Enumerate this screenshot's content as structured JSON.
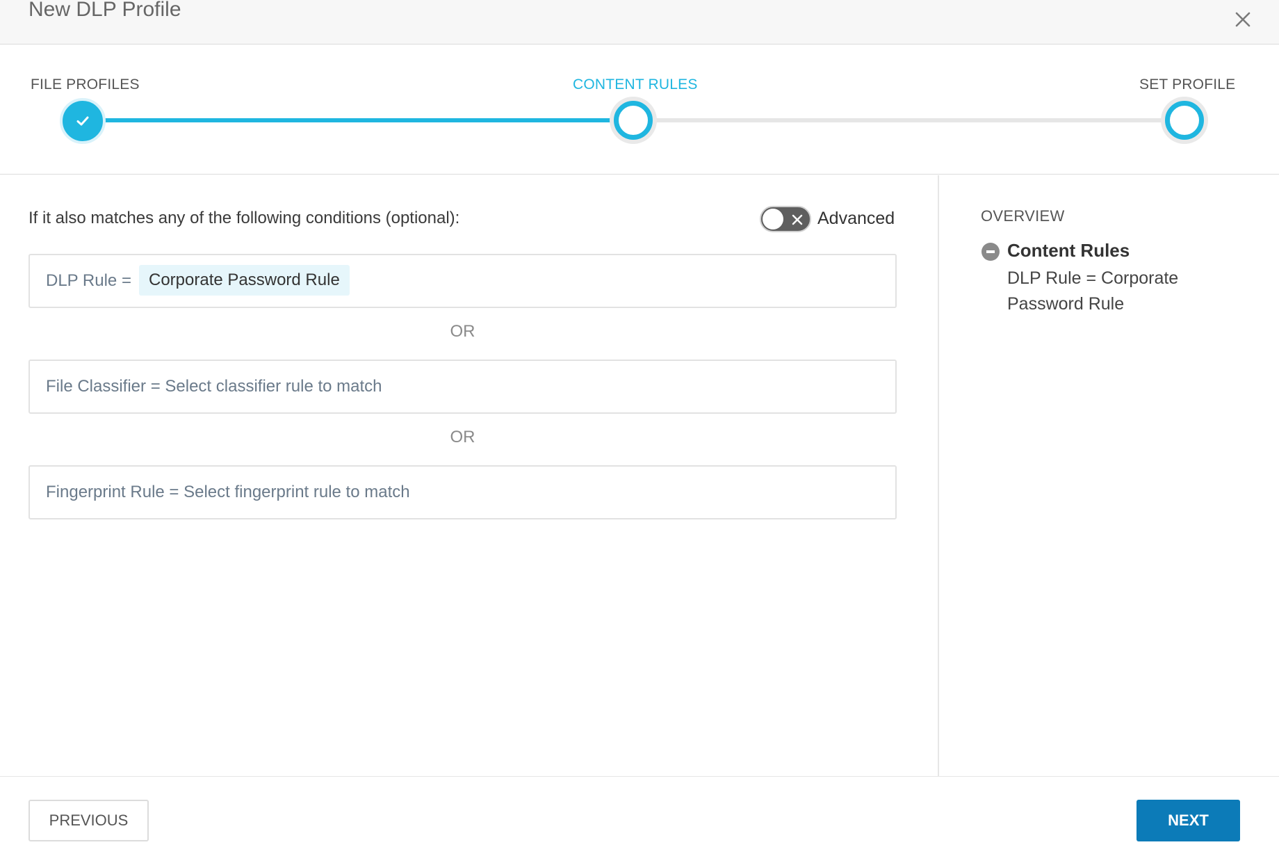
{
  "dialog": {
    "title": "New DLP Profile",
    "close_icon": "close-icon"
  },
  "stepper": {
    "steps": [
      {
        "label": "FILE PROFILES",
        "state": "completed"
      },
      {
        "label": "CONTENT RULES",
        "state": "active"
      },
      {
        "label": "SET PROFILE",
        "state": "pending"
      }
    ]
  },
  "conditions": {
    "intro": "If it also matches any of the following conditions (optional):",
    "advanced_toggle": {
      "label": "Advanced",
      "enabled": false
    },
    "rules": [
      {
        "prefix": "DLP Rule =",
        "value": "Corporate Password Rule"
      },
      {
        "prefix": "File Classifier =",
        "placeholder": "Select classifier rule to match"
      },
      {
        "prefix": "Fingerprint Rule =",
        "placeholder": "Select fingerprint rule to match"
      }
    ],
    "or_label": "OR"
  },
  "overview": {
    "title": "OVERVIEW",
    "heading": "Content Rules",
    "value": "DLP Rule = Corporate Password Rule"
  },
  "footer": {
    "previous_label": "PREVIOUS",
    "next_label": "NEXT"
  },
  "colors": {
    "accent": "#1fb6e0",
    "primary_button": "#0c7bb8",
    "chip_bg": "#e6f6fb"
  }
}
